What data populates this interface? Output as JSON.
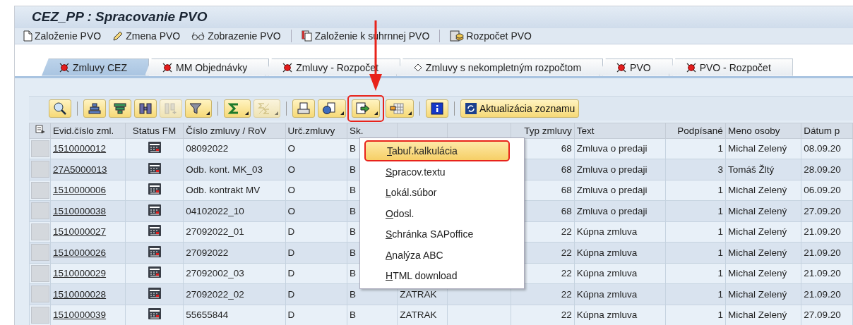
{
  "window": {
    "title": "CEZ_PP : Spracovanie PVO"
  },
  "app_toolbar": [
    {
      "kind": "new",
      "label": "Založenie PVO"
    },
    {
      "kind": "edit",
      "label": "Zmena PVO"
    },
    {
      "kind": "display",
      "label": "Zobrazenie PVO"
    },
    {
      "kind": "copy",
      "label": "Založenie k súhrnnej PVO"
    },
    {
      "kind": "budget",
      "label": "Rozpočet PVO"
    }
  ],
  "tabs": [
    {
      "label": "Zmluvy CEZ",
      "kind": "red_light",
      "selected": true
    },
    {
      "label": "MM Objednávky",
      "kind": "red_light",
      "selected": false
    },
    {
      "label": "Zmluvy - Rozpočet",
      "kind": "red_light",
      "selected": false
    },
    {
      "label": "Zmluvy s nekompletným rozpočtom",
      "kind": "diamond",
      "selected": false
    },
    {
      "label": "PVO",
      "kind": "red_light",
      "selected": false
    },
    {
      "label": "PVO - Rozpočet",
      "kind": "red_light",
      "selected": false
    }
  ],
  "alv_toolbar": [
    {
      "kind": "details",
      "dropdown": false,
      "disabled": false
    },
    {
      "kind": "sep"
    },
    {
      "kind": "sort_asc",
      "dropdown": false,
      "disabled": false
    },
    {
      "kind": "sort_desc",
      "dropdown": false,
      "disabled": false
    },
    {
      "kind": "find",
      "dropdown": false,
      "disabled": false
    },
    {
      "kind": "find_next",
      "dropdown": false,
      "disabled": true
    },
    {
      "kind": "filter",
      "dropdown": true,
      "disabled": false
    },
    {
      "kind": "sep"
    },
    {
      "kind": "sum",
      "dropdown": true,
      "disabled": false
    },
    {
      "kind": "subtotal",
      "dropdown": true,
      "disabled": true
    },
    {
      "kind": "sep"
    },
    {
      "kind": "print",
      "dropdown": false,
      "disabled": false
    },
    {
      "kind": "views",
      "dropdown": true,
      "disabled": false
    },
    {
      "kind": "export",
      "dropdown": true,
      "disabled": false,
      "highlighted": true
    },
    {
      "kind": "layout",
      "dropdown": true,
      "disabled": false
    },
    {
      "kind": "sep"
    },
    {
      "kind": "info",
      "dropdown": false,
      "disabled": false
    },
    {
      "kind": "sep"
    },
    {
      "kind": "refresh",
      "dropdown": false,
      "disabled": false,
      "label": "Aktualizácia zoznamu"
    }
  ],
  "table": {
    "columns": [
      "Evid.číslo zml.",
      "Status FM",
      "Číslo zmluvy / RoV",
      "Urč.zmluvy",
      "Sk.",
      null,
      null,
      "Typ zmluvy",
      "Text",
      "Podpísané",
      "Meno osoby",
      "Dátum p"
    ],
    "rows": [
      {
        "cells": [
          "1510000012",
          null,
          "08092022",
          "O",
          "B",
          null,
          null,
          "68",
          "Zmluva o predaji",
          "1",
          "Michal Zelený",
          "08.09.20"
        ]
      },
      {
        "cells": [
          "27A5000013",
          null,
          "Odb. kont. MK_03",
          "O",
          "B",
          null,
          null,
          "68",
          "Zmluva o predaji",
          "3",
          "Tomáš Žltý",
          "28.09.20"
        ]
      },
      {
        "cells": [
          "1510000006",
          null,
          "Odb. kontrakt MV",
          "O",
          "B",
          null,
          null,
          "68",
          "Zmluva o predaji",
          "1",
          "Michal Zelený",
          "06.09.20"
        ]
      },
      {
        "cells": [
          "1510000038",
          null,
          "04102022_10",
          "O",
          "B",
          null,
          null,
          "68",
          "Zmluva o predaji",
          "1",
          "Michal Zelený",
          "27.09.20"
        ]
      },
      {
        "cells": [
          "1510000027",
          null,
          "27092022_01",
          "D",
          "B",
          null,
          null,
          "22",
          "Kúpna zmluva",
          "1",
          "Michal Zelený",
          "21.09.20"
        ]
      },
      {
        "cells": [
          "1510000026",
          null,
          "27092022",
          "D",
          "B",
          null,
          null,
          "22",
          "Kúpna zmluva",
          "1",
          "Michal Zelený",
          "21.09.20"
        ]
      },
      {
        "cells": [
          "1510000029",
          null,
          "27092002_03",
          "D",
          "B",
          null,
          null,
          "22",
          "Kúpna zmluva",
          "1",
          "Michal Zelený",
          "21.09.20"
        ]
      },
      {
        "cells": [
          "1510000028",
          null,
          "27092022_02",
          "D",
          "B",
          "ZATRAK",
          null,
          "22",
          "Kúpna zmluva",
          "1",
          "Michal Zelený",
          "21.09.20"
        ]
      },
      {
        "cells": [
          "1510000039",
          null,
          "55655844",
          "D",
          "B",
          "ZATRAK",
          null,
          "22",
          "Kúpna zmluva",
          "1",
          "Michal Zelený",
          "27.09.20"
        ]
      }
    ]
  },
  "export_menu": {
    "items": [
      {
        "label": "Tabuľ.kalkulácia",
        "selected": true
      },
      {
        "label": "Spracov.textu",
        "selected": false
      },
      {
        "label": "Lokál.súbor",
        "selected": false
      },
      {
        "label": "Odosl.",
        "selected": false
      },
      {
        "label": "Schránka SAPoffice",
        "selected": false
      },
      {
        "label": "Analýza ABC",
        "selected": false
      },
      {
        "label": "HTML download",
        "selected": false
      }
    ]
  }
}
